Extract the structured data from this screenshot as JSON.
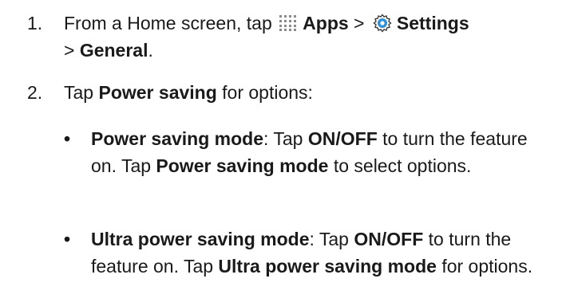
{
  "steps": [
    {
      "number": "1.",
      "text_before_apps": "From a Home screen, tap",
      "apps_label": "Apps",
      "sep1": ">",
      "settings_label": "Settings",
      "sep2": ">",
      "general_label": "General",
      "end": ".",
      "icons": [
        "apps-grid-icon",
        "settings-gear-icon"
      ],
      "icon_colors": {
        "apps": "#8a8a8a",
        "settings_outer": "#3a3a3a",
        "settings_inner": "#2f8fd8"
      }
    },
    {
      "number": "2.",
      "text_before": "Tap",
      "bold": "Power saving",
      "text_after": "for options:"
    }
  ],
  "bullets": [
    {
      "symbol": "•",
      "title": "Power saving mode",
      "colon": ":",
      "t1": "Tap",
      "b1": "ON/OFF",
      "t2": "to turn the feature on. Tap",
      "b2": "Power saving mode",
      "t3": "to select options."
    },
    {
      "symbol": "•",
      "title": "Ultra power saving mode",
      "colon": ":",
      "t1": "Tap",
      "b1": "ON/OFF",
      "t2": "to turn the feature on. Tap",
      "b2": "Ultra power saving mode",
      "t3": "for options."
    }
  ]
}
